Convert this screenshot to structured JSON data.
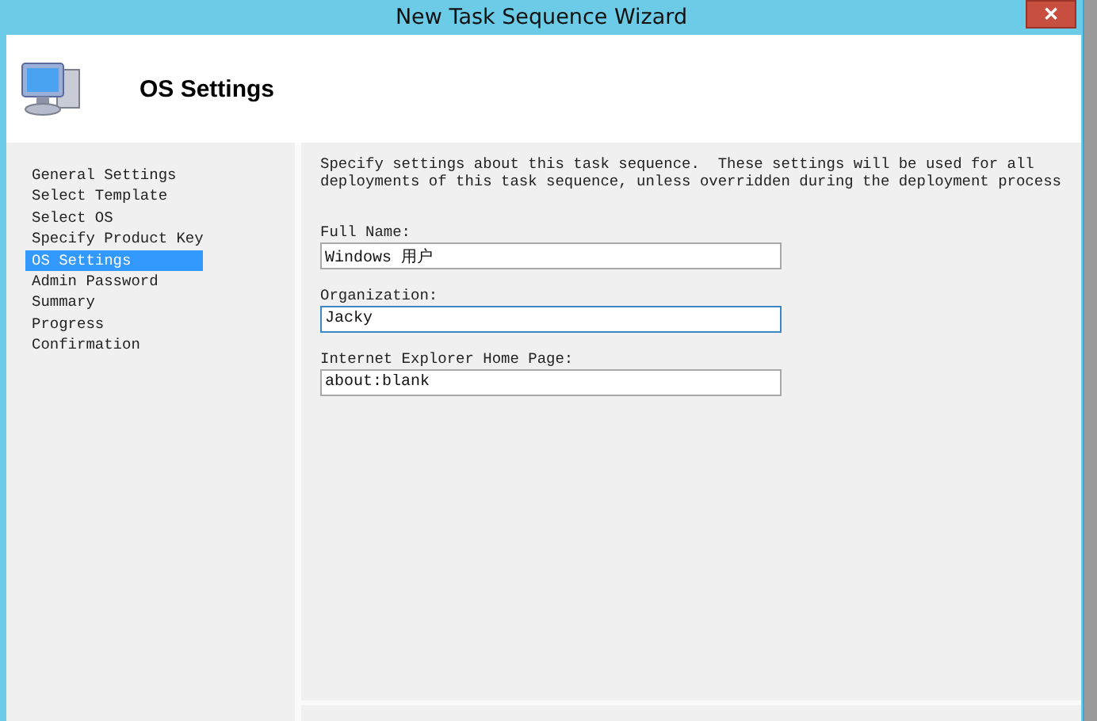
{
  "window": {
    "title": "New Task Sequence Wizard",
    "close": "✕"
  },
  "header": {
    "title": "OS Settings"
  },
  "steps": [
    {
      "label": "General Settings",
      "selected": false
    },
    {
      "label": "Select Template",
      "selected": false
    },
    {
      "label": "Select OS",
      "selected": false
    },
    {
      "label": "Specify Product Key",
      "selected": false
    },
    {
      "label": "OS Settings",
      "selected": true
    },
    {
      "label": "Admin Password",
      "selected": false
    },
    {
      "label": "Summary",
      "selected": false
    },
    {
      "label": "Progress",
      "selected": false
    },
    {
      "label": "Confirmation",
      "selected": false
    }
  ],
  "description": "Specify settings about this task sequence.  These settings will be used for all deployments of this task sequence, unless overridden during the deployment process",
  "fields": [
    {
      "label": "Full Name:",
      "value": "Windows 用户",
      "focused": false
    },
    {
      "label": "Organization:",
      "value": "Jacky",
      "focused": true
    },
    {
      "label": "Internet Explorer Home Page:",
      "value": "about:blank",
      "focused": false
    }
  ]
}
